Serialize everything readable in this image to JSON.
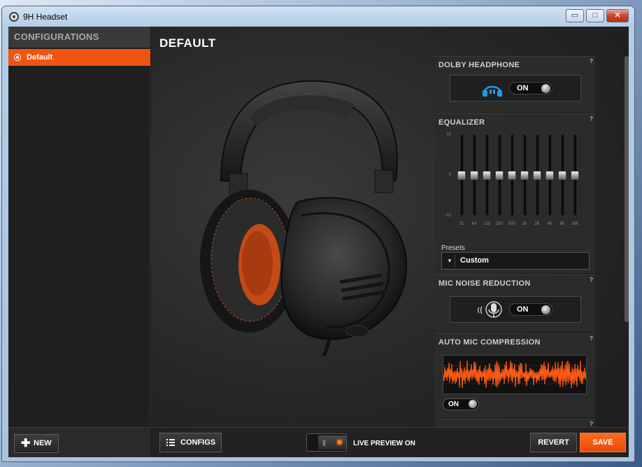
{
  "window": {
    "title": "9H Headset",
    "controls": {
      "minimize": "▭",
      "maximize": "□",
      "close": "✕"
    }
  },
  "sidebar": {
    "header": "CONFIGURATIONS",
    "items": [
      {
        "label": "Default",
        "selected": true
      }
    ],
    "new_button": "NEW"
  },
  "main": {
    "title": "DEFAULT"
  },
  "panel": {
    "dolby": {
      "title": "DOLBY HEADPHONE",
      "help": "?",
      "state": "ON",
      "icon": "headphone-icon"
    },
    "equalizer": {
      "title": "EQUALIZER",
      "help": "?",
      "scale": {
        "top": "12",
        "mid": "0",
        "bottom": "-12"
      },
      "bands": [
        {
          "label": "32",
          "value": 0
        },
        {
          "label": "64",
          "value": 0
        },
        {
          "label": "125",
          "value": 0
        },
        {
          "label": "250",
          "value": 0
        },
        {
          "label": "500",
          "value": 0
        },
        {
          "label": "1K",
          "value": 0
        },
        {
          "label": "2K",
          "value": 0
        },
        {
          "label": "4K",
          "value": 0
        },
        {
          "label": "8K",
          "value": 0
        },
        {
          "label": "16K",
          "value": 0
        }
      ],
      "presets_label": "Presets",
      "presets_value": "Custom"
    },
    "mic_noise": {
      "title": "MIC NOISE REDUCTION",
      "help": "?",
      "state": "ON",
      "icon": "microphone-icon"
    },
    "auto_mic": {
      "title": "AUTO MIC COMPRESSION",
      "help": "?",
      "state": "ON"
    },
    "more": {
      "help": "?"
    }
  },
  "bottombar": {
    "configs_button": "CONFIGS",
    "live_preview": "LIVE PREVIEW ON",
    "revert_button": "REVERT",
    "save_button": "SAVE"
  },
  "colors": {
    "accent": "#ee5512",
    "dolby_icon": "#1e9be8",
    "waveform": "#ff5a14"
  }
}
